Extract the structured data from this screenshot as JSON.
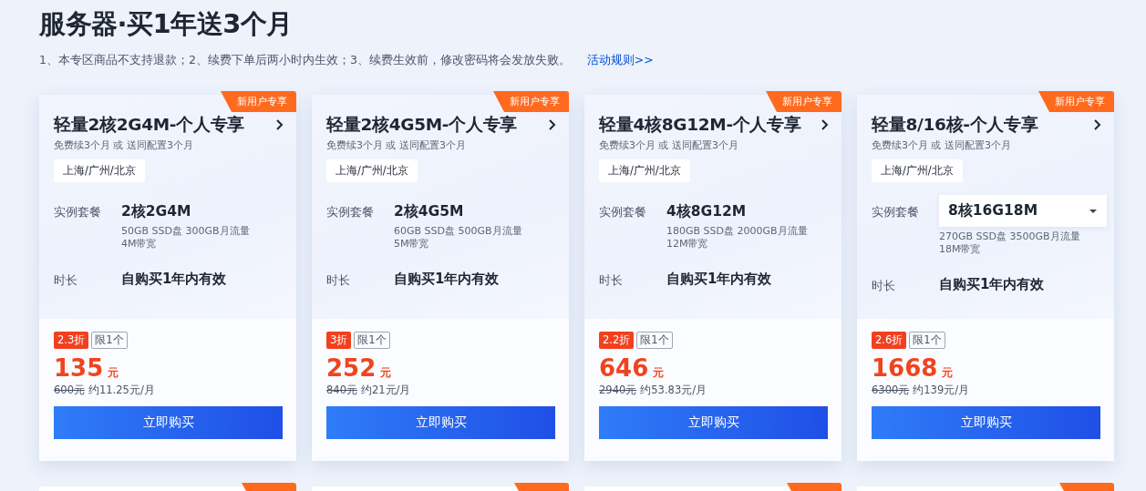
{
  "header": {
    "title": "服务器·买1年送3个月",
    "notice": "1、本专区商品不支持退款；2、续费下单后两小时内生效；3、续费生效前，修改密码将会发放失败。",
    "rules_link": "活动规则>>"
  },
  "cards": [
    {
      "badge": "新用户专享",
      "title": "轻量2核2G4M-个人专享",
      "subtitle": "免费续3个月 或 送同配置3个月",
      "region": "上海/广州/北京",
      "package_label": "实例套餐",
      "package": {
        "kind": "text",
        "value": "2核2G4M"
      },
      "specs": [
        "50GB SSD盘 300GB月流量",
        "4M带宽"
      ],
      "duration_label": "时长",
      "duration": "自购买1年内有效",
      "discount": "2.3折",
      "limit": "限1个",
      "price": "135",
      "currency": "元",
      "original_price": "600元",
      "monthly": "约11.25元/月",
      "buy": "立即购买"
    },
    {
      "badge": "新用户专享",
      "title": "轻量2核4G5M-个人专享",
      "subtitle": "免费续3个月 或 送同配置3个月",
      "region": "上海/广州/北京",
      "package_label": "实例套餐",
      "package": {
        "kind": "text",
        "value": "2核4G5M"
      },
      "specs": [
        "60GB SSD盘 500GB月流量",
        "5M带宽"
      ],
      "duration_label": "时长",
      "duration": "自购买1年内有效",
      "discount": "3折",
      "limit": "限1个",
      "price": "252",
      "currency": "元",
      "original_price": "840元",
      "monthly": "约21元/月",
      "buy": "立即购买"
    },
    {
      "badge": "新用户专享",
      "title": "轻量4核8G12M-个人专享",
      "subtitle": "免费续3个月 或 送同配置3个月",
      "region": "上海/广州/北京",
      "package_label": "实例套餐",
      "package": {
        "kind": "text",
        "value": "4核8G12M"
      },
      "specs": [
        "180GB SSD盘 2000GB月流量",
        "12M带宽"
      ],
      "duration_label": "时长",
      "duration": "自购买1年内有效",
      "discount": "2.2折",
      "limit": "限1个",
      "price": "646",
      "currency": "元",
      "original_price": "2940元",
      "monthly": "约53.83元/月",
      "buy": "立即购买"
    },
    {
      "badge": "新用户专享",
      "title": "轻量8/16核-个人专享",
      "subtitle": "免费续3个月 或 送同配置3个月",
      "region": "上海/广州/北京",
      "package_label": "实例套餐",
      "package": {
        "kind": "select",
        "value": "8核16G18M"
      },
      "specs": [
        "270GB SSD盘 3500GB月流量",
        "18M带宽"
      ],
      "duration_label": "时长",
      "duration": "自购买1年内有效",
      "discount": "2.6折",
      "limit": "限1个",
      "price": "1668",
      "currency": "元",
      "original_price": "6300元",
      "monthly": "约139元/月",
      "buy": "立即购买"
    }
  ],
  "next_row_cards": [
    {
      "kind": "partial"
    },
    {
      "kind": "partial"
    },
    {
      "kind": "partial"
    },
    {
      "kind": "partial"
    }
  ]
}
